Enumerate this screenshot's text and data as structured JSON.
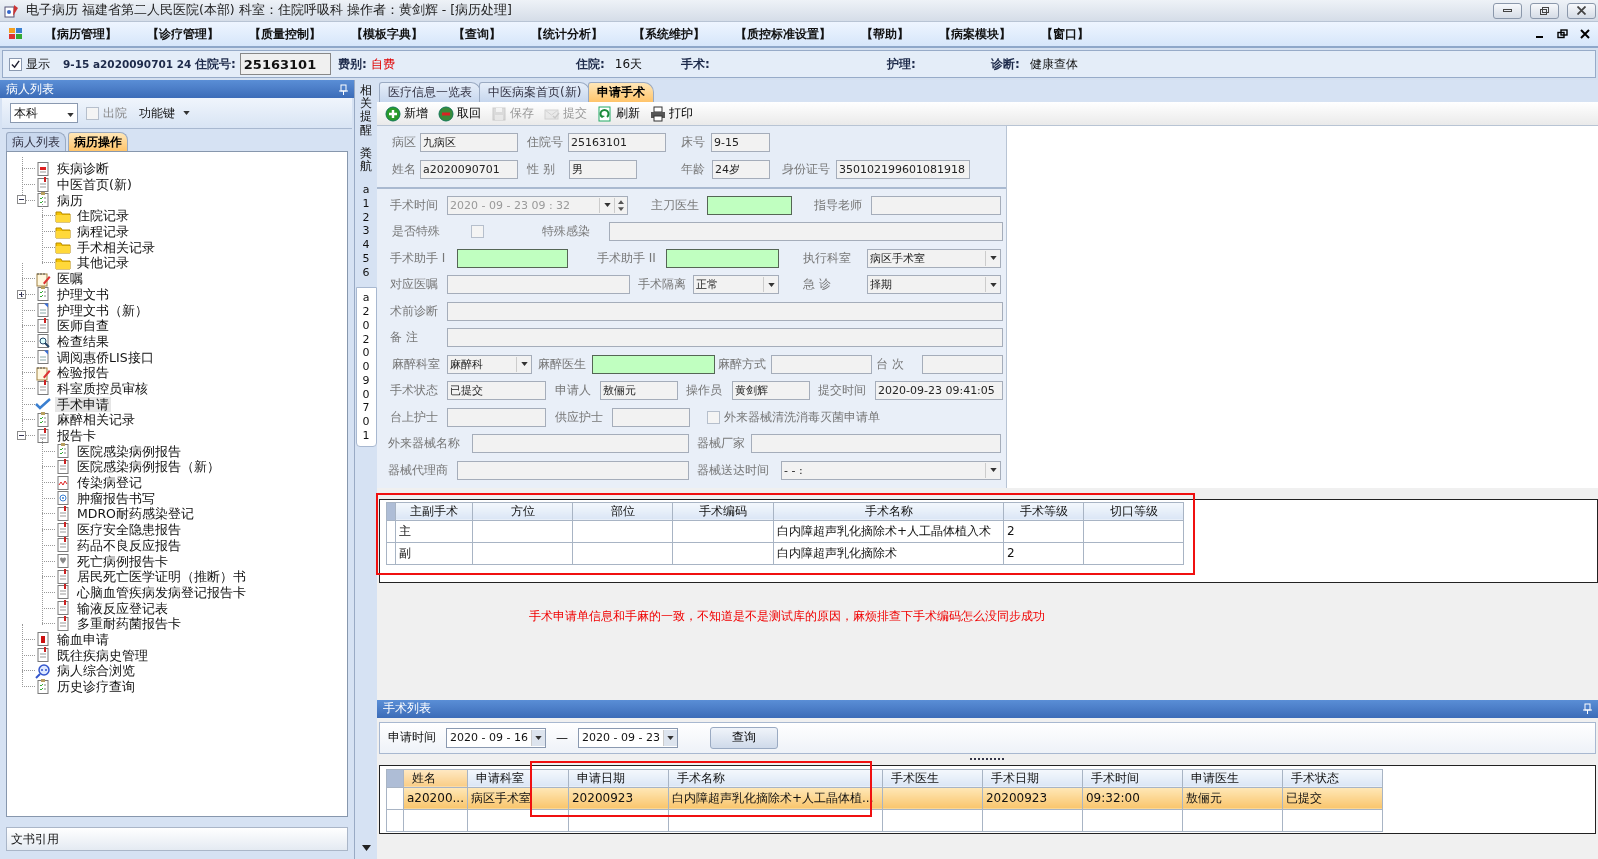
{
  "window": {
    "title": "电子病历  福建省第二人民医院(本部)  科室：住院呼吸科  操作者：黄剑辉 - [病历处理]"
  },
  "menu": [
    "【病历管理】",
    "【诊疗管理】",
    "【质量控制】",
    "【模板字典】",
    "【查询】",
    "【统计分析】",
    "【系统维护】",
    "【质控标准设置】",
    "【帮助】",
    "【病案模块】",
    "【窗口】"
  ],
  "patient_bar": {
    "show": {
      "label": "显示",
      "checked": true
    },
    "bed_and_name": "9-15  a2020090701 24",
    "fields": [
      {
        "label": "住院号:",
        "value": "25163101",
        "kind": "input"
      },
      {
        "label": "费别:",
        "value": "自费",
        "kind": "alert"
      },
      {
        "label": "住院:",
        "value": "16天",
        "kind": "plain"
      },
      {
        "label": "手术:",
        "kind": "plain"
      },
      {
        "label": "护理:",
        "kind": "plain"
      },
      {
        "label": "诊断:",
        "value": "健康查体",
        "kind": "plain"
      }
    ]
  },
  "left_panel": {
    "title": "病人列表",
    "ward": "本科",
    "discharged": {
      "label": "出院",
      "checked": false
    },
    "function_key": "功能键",
    "tabs": [
      {
        "label": "病人列表",
        "selected": false
      },
      {
        "label": "病历操作",
        "selected": true
      }
    ],
    "tree": [
      {
        "label": "疾病诊断",
        "kind": "report",
        "selected": false
      },
      {
        "label": "中医首页(新)",
        "kind": "doc",
        "selected": false
      },
      {
        "label": "病历",
        "kind": "list",
        "selected": false,
        "expanded": true,
        "children": [
          {
            "label": "住院记录",
            "kind": "folder",
            "selected": false
          },
          {
            "label": "病程记录",
            "kind": "folder",
            "selected": false
          },
          {
            "label": "手术相关记录",
            "kind": "folder",
            "selected": false
          },
          {
            "label": "其他记录",
            "kind": "folder",
            "selected": false
          }
        ]
      },
      {
        "label": "医嘱",
        "kind": "memo",
        "selected": false
      },
      {
        "label": "护理文书",
        "kind": "list",
        "selected": false,
        "expanded": false
      },
      {
        "label": "护理文书（新）",
        "kind": "page",
        "selected": false
      },
      {
        "label": "医师自查",
        "kind": "doc",
        "selected": false
      },
      {
        "label": "检查结果",
        "kind": "search",
        "selected": false
      },
      {
        "label": "调阅惠侨LIS接口",
        "kind": "page",
        "selected": false
      },
      {
        "label": "检验报告",
        "kind": "memo",
        "selected": false
      },
      {
        "label": "科室质控员审核",
        "kind": "doc",
        "selected": false
      },
      {
        "label": "手术申请",
        "kind": "check",
        "selected": true
      },
      {
        "label": "麻醉相关记录",
        "kind": "list",
        "selected": false
      },
      {
        "label": "报告卡",
        "kind": "doc",
        "selected": false,
        "expanded": true,
        "children": [
          {
            "label": "医院感染病例报告",
            "kind": "list",
            "selected": false
          },
          {
            "label": "医院感染病例报告（新）",
            "kind": "doc",
            "selected": false
          },
          {
            "label": "传染病登记",
            "kind": "pulse",
            "selected": false
          },
          {
            "label": "肿瘤报告书写",
            "kind": "target",
            "selected": false
          },
          {
            "label": "MDRO耐药感染登记",
            "kind": "doc",
            "selected": false
          },
          {
            "label": "医疗安全隐患报告",
            "kind": "doc",
            "selected": false
          },
          {
            "label": "药品不良反应报告",
            "kind": "doc",
            "selected": false
          },
          {
            "label": "死亡病例报告卡",
            "kind": "shield",
            "selected": false
          },
          {
            "label": "居民死亡医学证明（推断）书",
            "kind": "doc",
            "selected": false
          },
          {
            "label": "心脑血管疾病发病登记报告卡",
            "kind": "doc",
            "selected": false
          },
          {
            "label": "输液反应登记表",
            "kind": "doc",
            "selected": false
          },
          {
            "label": "多重耐药菌报告卡",
            "kind": "doc",
            "selected": false
          }
        ]
      },
      {
        "label": "输血申请",
        "kind": "blood",
        "selected": false
      },
      {
        "label": "既往疾病史管理",
        "kind": "doc",
        "selected": false
      },
      {
        "label": "病人综合浏览",
        "kind": "browse",
        "selected": false
      },
      {
        "label": "历史诊疗查询",
        "kind": "list",
        "selected": false
      }
    ],
    "footer": "文书引用"
  },
  "side_strip": {
    "tabs": [
      {
        "label": "相关提醒",
        "selected": false
      },
      {
        "label": "粪航",
        "selected": false
      },
      {
        "label": "a123456",
        "selected": false
      },
      {
        "label": "a2020090701",
        "selected": true
      }
    ]
  },
  "main": {
    "tabs": [
      {
        "label": "医疗信息一览表",
        "selected": false
      },
      {
        "label": "中医病案首页(新)",
        "selected": false
      },
      {
        "label": "申请手术",
        "selected": true
      }
    ],
    "toolbar": [
      {
        "label": "新增",
        "kind": "add",
        "disabled": false
      },
      {
        "label": "取回",
        "kind": "remove",
        "disabled": false
      },
      {
        "label": "保存",
        "kind": "save",
        "disabled": true
      },
      {
        "label": "提交",
        "kind": "submit",
        "disabled": true
      },
      {
        "label": "刷新",
        "kind": "refresh",
        "disabled": false
      },
      {
        "label": "打印",
        "kind": "print",
        "disabled": false
      }
    ],
    "patient_header": [
      [
        {
          "label": "病区",
          "kind": "text",
          "value": "九病区"
        },
        {
          "label": "住院号",
          "kind": "text",
          "value": "25163101"
        },
        {
          "label": "床号",
          "kind": "text",
          "value": "9-15"
        }
      ],
      [
        {
          "label": "姓名",
          "kind": "text",
          "value": "a2020090701"
        },
        {
          "label": "性  别",
          "kind": "text",
          "value": "男"
        },
        {
          "label": "年龄",
          "kind": "text",
          "value": "24岁"
        },
        {
          "label": "身份证号",
          "kind": "text",
          "value": "350102199601081918"
        }
      ]
    ],
    "form": [
      [
        {
          "label": "手术时间",
          "kind": "datetime",
          "value": "2020 - 09 - 23    09 : 32",
          "disabled": true
        },
        {
          "label": "主刀医生",
          "kind": "text",
          "required": true
        },
        {
          "label": "指导老师",
          "kind": "text"
        }
      ],
      [
        {
          "label": "是否特殊",
          "kind": "check",
          "checked": false
        },
        {
          "label": "特殊感染",
          "kind": "text"
        }
      ],
      [
        {
          "label": "手术助手 I",
          "kind": "text",
          "required": true
        },
        {
          "label": "手术助手 II",
          "kind": "text",
          "required": true
        },
        {
          "label": "执行科室",
          "kind": "combo",
          "value": "病区手术室"
        }
      ],
      [
        {
          "label": "对应医嘱",
          "kind": "text"
        },
        {
          "label": "手术隔离",
          "kind": "combo",
          "value": "正常"
        },
        {
          "label": "急    诊",
          "kind": "combo",
          "value": "择期"
        }
      ],
      [
        {
          "label": "术前诊断",
          "kind": "text"
        }
      ],
      [
        {
          "label": "备    注",
          "kind": "text"
        }
      ],
      [
        {
          "label": "麻醉科室",
          "kind": "combo",
          "value": "麻醉科"
        },
        {
          "label": "麻醉医生",
          "kind": "text",
          "required": true
        },
        {
          "label": "麻醉方式",
          "kind": "text"
        },
        {
          "label": "台    次",
          "kind": "text"
        }
      ],
      [
        {
          "label": "手术状态",
          "kind": "text",
          "value": "已提交"
        },
        {
          "label": "申请人",
          "kind": "text",
          "value": "敖俪元"
        },
        {
          "label": "操作员",
          "kind": "text",
          "value": "黄剑辉"
        },
        {
          "label": "提交时间",
          "kind": "text",
          "value": "2020-09-23 09:41:05"
        }
      ],
      [
        {
          "label": "台上护士",
          "kind": "text"
        },
        {
          "label": "供应护士",
          "kind": "text"
        },
        {
          "label": "外来器械清洗消毒灭菌申请单",
          "kind": "check_after",
          "checked": false
        }
      ],
      [
        {
          "label": "外来器械名称",
          "kind": "text"
        },
        {
          "label": "器械厂家",
          "kind": "text"
        }
      ],
      [
        {
          "label": "器械代理商",
          "kind": "text"
        },
        {
          "label": "器械送达时间",
          "kind": "combo",
          "value": "-   -          :"
        }
      ]
    ],
    "surgery_table": {
      "columns": [
        "主副手术",
        "方位",
        "部位",
        "手术编码",
        "手术名称",
        "手术等级",
        "切口等级"
      ],
      "rows": [
        [
          "主",
          null,
          null,
          null,
          "白内障超声乳化摘除术+人工晶体植入术",
          "2",
          null
        ],
        [
          "副",
          null,
          null,
          null,
          "白内障超声乳化摘除术",
          "2",
          null
        ]
      ]
    },
    "note": "手术申请单信息和手麻的一致，不知道是不是测试库的原因，麻烦排查下手术编码怎么没同步成功",
    "surgery_list": {
      "title": "手术列表",
      "query": {
        "label": "申请时间",
        "from": "2020 - 09 - 16",
        "separator": "—",
        "to": "2020 - 09 - 23",
        "button": "查询"
      },
      "columns": [
        {
          "label": "姓名",
          "sorted": true
        },
        {
          "label": "申请科室",
          "sorted": false
        },
        {
          "label": "申请日期",
          "sorted": false
        },
        {
          "label": "手术名称",
          "sorted": false
        },
        {
          "label": "手术医生",
          "sorted": false
        },
        {
          "label": "手术日期",
          "sorted": false
        },
        {
          "label": "手术时间",
          "sorted": false
        },
        {
          "label": "申请医生",
          "sorted": false
        },
        {
          "label": "手术状态",
          "sorted": false
        }
      ],
      "rows": [
        {
          "selected": true,
          "cells": [
            "a20200...",
            "病区手术室",
            "20200923",
            "白内障超声乳化摘除术+人工晶体植...",
            null,
            "20200923",
            "09:32:00",
            "敖俪元",
            "已提交"
          ]
        }
      ]
    }
  }
}
